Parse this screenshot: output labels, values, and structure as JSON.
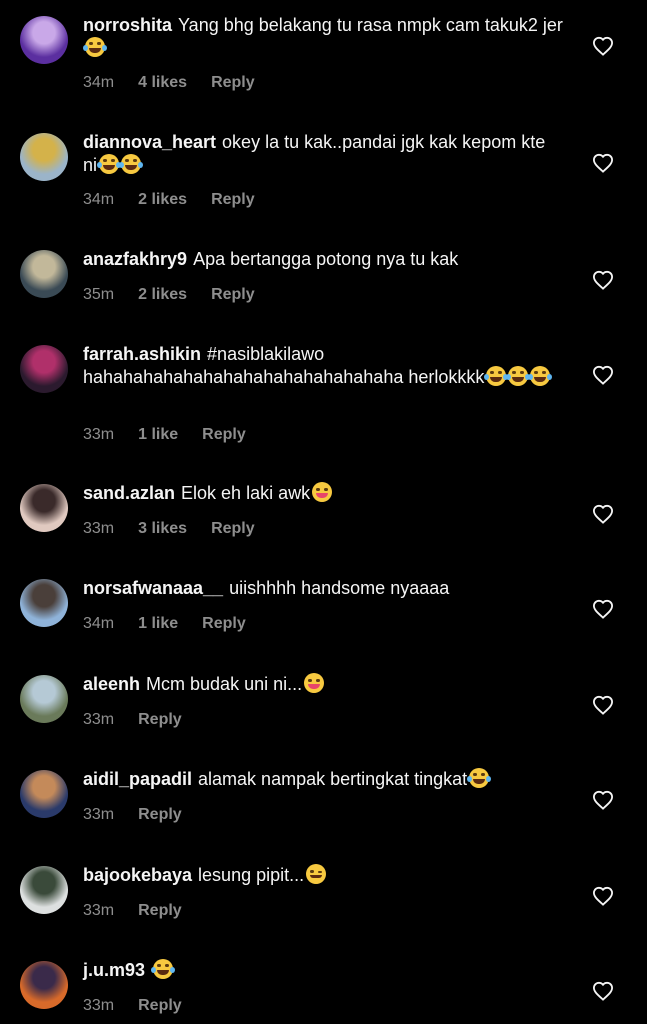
{
  "comments": [
    {
      "username": "norroshita",
      "text": "Yang bhg belakang tu rasa nmpk cam takuk2 jer",
      "emojis": [
        "rofl"
      ],
      "time": "34m",
      "likes": "4 likes",
      "reply": "Reply",
      "avatar_colors": [
        "#5b2fa0",
        "#c9a8e8"
      ]
    },
    {
      "username": "diannova_heart",
      "text": "okey la tu kak..pandai jgk kak kepom kte ni",
      "emojis": [
        "rofl",
        "rofl"
      ],
      "time": "34m",
      "likes": "2 likes",
      "reply": "Reply",
      "avatar_colors": [
        "#9bb4c9",
        "#d4b24a"
      ]
    },
    {
      "username": "anazfakhry9",
      "text": "Apa bertangga potong nya tu kak",
      "emojis": [],
      "time": "35m",
      "likes": "2 likes",
      "reply": "Reply",
      "avatar_colors": [
        "#3a4a55",
        "#c2b89a"
      ]
    },
    {
      "username": "farrah.ashikin",
      "text": "#nasiblakilawo hahahahahahahahahahahahahahahaha herlokkkk",
      "emojis": [
        "joy",
        "joy",
        "joy"
      ],
      "time": "33m",
      "likes": "1 like",
      "reply": "Reply",
      "avatar_colors": [
        "#2b1a2e",
        "#b0306a"
      ]
    },
    {
      "username": "sand.azlan",
      "text": "Elok eh laki awk",
      "emojis": [
        "tongue"
      ],
      "time": "33m",
      "likes": "3 likes",
      "reply": "Reply",
      "avatar_colors": [
        "#e0c9c0",
        "#3a2a2a"
      ]
    },
    {
      "username": "norsafwanaaa__",
      "text": "uiishhhh handsome nyaaaa",
      "emojis": [],
      "time": "34m",
      "likes": "1 like",
      "reply": "Reply",
      "avatar_colors": [
        "#8fb3d9",
        "#4a3f3a"
      ]
    },
    {
      "username": "aleenh",
      "text": "Mcm budak uni ni...",
      "emojis": [
        "zany"
      ],
      "time": "33m",
      "likes": "",
      "reply": "Reply",
      "avatar_colors": [
        "#6a7a5a",
        "#b5c9d5"
      ]
    },
    {
      "username": "aidil_papadil",
      "text": "alamak nampak bertingkat tingkat",
      "emojis": [
        "joy"
      ],
      "time": "33m",
      "likes": "",
      "reply": "Reply",
      "avatar_colors": [
        "#2a3a6a",
        "#c48a5a"
      ]
    },
    {
      "username": "bajookebaya",
      "text": "lesung pipit...",
      "emojis": [
        "wink"
      ],
      "time": "33m",
      "likes": "",
      "reply": "Reply",
      "avatar_colors": [
        "#dde0e0",
        "#3a4a3a"
      ]
    },
    {
      "username": "j.u.m93",
      "text": "",
      "emojis": [
        "joy"
      ],
      "time": "33m",
      "likes": "",
      "reply": "Reply",
      "avatar_colors": [
        "#d86a2a",
        "#3a2a4a"
      ]
    }
  ],
  "icons": {
    "like": "heart-outline-icon"
  },
  "colors": {
    "background": "#000000",
    "text": "#f5f5f5",
    "meta": "#8e8e8e",
    "emoji": "#f7c940"
  }
}
